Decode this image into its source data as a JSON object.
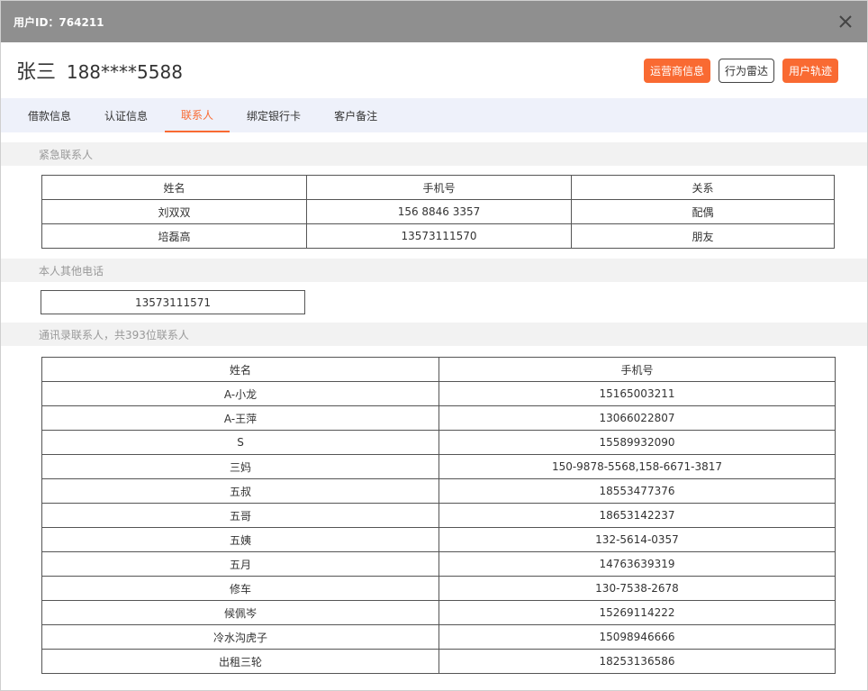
{
  "titlebar": {
    "user_id": "用户ID：764211"
  },
  "header": {
    "name": "张三",
    "phone": "188****5588",
    "buttons": {
      "operator": "运营商信息",
      "radar": "行为雷达",
      "track": "用户轨迹"
    }
  },
  "tabs": [
    {
      "label": "借款信息"
    },
    {
      "label": "认证信息"
    },
    {
      "label": "联系人"
    },
    {
      "label": "绑定银行卡"
    },
    {
      "label": "客户备注"
    }
  ],
  "active_tab": "联系人",
  "emergency": {
    "title": "紧急联系人",
    "headers": [
      "姓名",
      "手机号",
      "关系"
    ],
    "rows": [
      [
        "刘双双",
        "156 8846 3357",
        "配偶"
      ],
      [
        "培磊高",
        "13573111570",
        "朋友"
      ]
    ]
  },
  "other_phone": {
    "title": "本人其他电话",
    "value": "13573111571"
  },
  "contacts": {
    "title": "通讯录联系人，共393位联系人",
    "headers": [
      "姓名",
      "手机号"
    ],
    "rows": [
      [
        "A-小龙",
        "15165003211"
      ],
      [
        "A-王萍",
        "13066022807"
      ],
      [
        "S",
        "15589932090"
      ],
      [
        "三妈",
        "150-9878-5568,158-6671-3817"
      ],
      [
        "五叔",
        "18553477376"
      ],
      [
        "五哥",
        "18653142237"
      ],
      [
        "五姨",
        "132-5614-0357"
      ],
      [
        "五月",
        "14763639319"
      ],
      [
        "修车",
        "130-7538-2678"
      ],
      [
        "候佩岑",
        "15269114222"
      ],
      [
        "冷水沟虎子",
        "15098946666"
      ],
      [
        "出租三轮",
        "18253136586"
      ]
    ]
  },
  "colors": {
    "accent": "#f96a32",
    "titlebar": "#8f8f8f",
    "tabbar": "#eef1fa"
  },
  "icons": {
    "close": "close-icon"
  }
}
